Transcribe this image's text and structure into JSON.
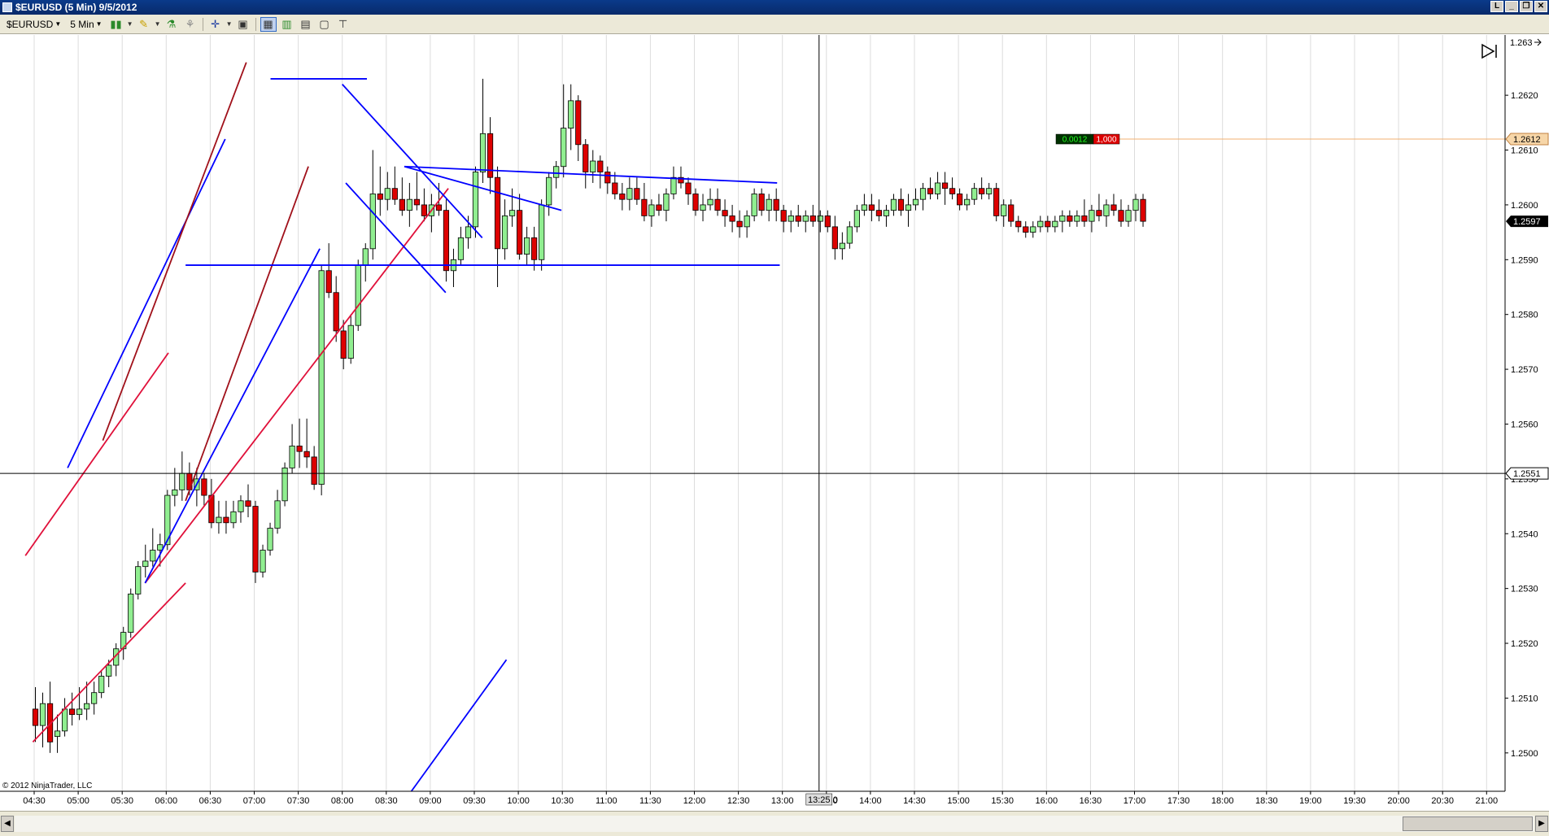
{
  "window": {
    "title": "$EURUSD (5 Min)  9/5/2012"
  },
  "toolbar": {
    "instrument": "$EURUSD",
    "interval": "5 Min"
  },
  "chart_data": {
    "type": "candlestick",
    "instrument": "$EURUSD",
    "interval": "5 Min",
    "date": "9/5/2012",
    "copyright": "© 2012 NinjaTrader, LLC",
    "ylim": [
      1.2493,
      1.2631
    ],
    "y_ticks": [
      "1.2500",
      "1.2510",
      "1.2520",
      "1.2530",
      "1.2540",
      "1.2550",
      "1.2560",
      "1.2570",
      "1.2580",
      "1.2590",
      "1.2600",
      "1.2610",
      "1.2620"
    ],
    "x_ticks": [
      "04:30",
      "05:00",
      "05:30",
      "06:00",
      "06:30",
      "07:00",
      "07:30",
      "08:00",
      "08:30",
      "09:00",
      "09:30",
      "10:00",
      "10:30",
      "11:00",
      "11:30",
      "12:00",
      "12:30",
      "13:00",
      "13:30",
      "14:00",
      "14:30",
      "15:00",
      "15:30",
      "16:00",
      "16:30",
      "17:00",
      "17:30",
      "18:00",
      "18:30",
      "19:00",
      "19:30",
      "20:00",
      "20:30",
      "21:00"
    ],
    "price_labels": {
      "top": "1.263",
      "order": "1.2612",
      "last": "1.2597",
      "crosshair": "1.2551"
    },
    "crosshair": {
      "time": "13:25",
      "price": 1.2551,
      "time_label": "13:25",
      "time_label_suffix": "0"
    },
    "order_line": {
      "price": 1.2612,
      "pnl": "0.0012",
      "qty": "1,000"
    },
    "candles": [
      [
        1.2508,
        1.2512,
        1.2502,
        1.2505
      ],
      [
        1.2505,
        1.2511,
        1.2501,
        1.2509
      ],
      [
        1.2509,
        1.2513,
        1.25,
        1.2502
      ],
      [
        1.2503,
        1.2507,
        1.25,
        1.2504
      ],
      [
        1.2504,
        1.251,
        1.2503,
        1.2508
      ],
      [
        1.2508,
        1.2511,
        1.2505,
        1.2507
      ],
      [
        1.2507,
        1.2512,
        1.2506,
        1.2508
      ],
      [
        1.2508,
        1.2513,
        1.2506,
        1.2509
      ],
      [
        1.2509,
        1.2513,
        1.2507,
        1.2511
      ],
      [
        1.2511,
        1.2515,
        1.251,
        1.2514
      ],
      [
        1.2514,
        1.2517,
        1.2512,
        1.2516
      ],
      [
        1.2516,
        1.252,
        1.2514,
        1.2519
      ],
      [
        1.2519,
        1.2523,
        1.2517,
        1.2522
      ],
      [
        1.2522,
        1.253,
        1.2521,
        1.2529
      ],
      [
        1.2529,
        1.2535,
        1.2528,
        1.2534
      ],
      [
        1.2534,
        1.2538,
        1.2532,
        1.2535
      ],
      [
        1.2535,
        1.2541,
        1.2534,
        1.2537
      ],
      [
        1.2537,
        1.254,
        1.2534,
        1.2538
      ],
      [
        1.2538,
        1.2548,
        1.2537,
        1.2547
      ],
      [
        1.2547,
        1.2552,
        1.2545,
        1.2548
      ],
      [
        1.2548,
        1.2555,
        1.2546,
        1.2551
      ],
      [
        1.2551,
        1.2553,
        1.2547,
        1.2548
      ],
      [
        1.2548,
        1.2552,
        1.2545,
        1.255
      ],
      [
        1.255,
        1.2551,
        1.2545,
        1.2547
      ],
      [
        1.2547,
        1.255,
        1.2541,
        1.2542
      ],
      [
        1.2542,
        1.2546,
        1.254,
        1.2543
      ],
      [
        1.2543,
        1.2546,
        1.254,
        1.2542
      ],
      [
        1.2542,
        1.2546,
        1.2541,
        1.2544
      ],
      [
        1.2544,
        1.2547,
        1.2542,
        1.2546
      ],
      [
        1.2546,
        1.2549,
        1.2543,
        1.2545
      ],
      [
        1.2545,
        1.2546,
        1.2531,
        1.2533
      ],
      [
        1.2533,
        1.2538,
        1.2532,
        1.2537
      ],
      [
        1.2537,
        1.2542,
        1.2536,
        1.2541
      ],
      [
        1.2541,
        1.2548,
        1.254,
        1.2546
      ],
      [
        1.2546,
        1.2553,
        1.2545,
        1.2552
      ],
      [
        1.2552,
        1.256,
        1.2551,
        1.2556
      ],
      [
        1.2556,
        1.2561,
        1.2552,
        1.2555
      ],
      [
        1.2555,
        1.2561,
        1.2552,
        1.2554
      ],
      [
        1.2554,
        1.2556,
        1.2548,
        1.2549
      ],
      [
        1.2549,
        1.2589,
        1.2547,
        1.2588
      ],
      [
        1.2588,
        1.2593,
        1.2583,
        1.2584
      ],
      [
        1.2584,
        1.2587,
        1.2575,
        1.2577
      ],
      [
        1.2577,
        1.2579,
        1.257,
        1.2572
      ],
      [
        1.2572,
        1.258,
        1.2571,
        1.2578
      ],
      [
        1.2578,
        1.259,
        1.2577,
        1.2589
      ],
      [
        1.2589,
        1.2593,
        1.2586,
        1.2592
      ],
      [
        1.2592,
        1.261,
        1.259,
        1.2602
      ],
      [
        1.2602,
        1.2607,
        1.2598,
        1.2601
      ],
      [
        1.2601,
        1.2606,
        1.2599,
        1.2603
      ],
      [
        1.2603,
        1.2607,
        1.26,
        1.2601
      ],
      [
        1.2601,
        1.2605,
        1.2598,
        1.2599
      ],
      [
        1.2599,
        1.2604,
        1.2596,
        1.2601
      ],
      [
        1.2601,
        1.2606,
        1.2599,
        1.26
      ],
      [
        1.26,
        1.2603,
        1.2597,
        1.2598
      ],
      [
        1.2598,
        1.2602,
        1.2595,
        1.26
      ],
      [
        1.26,
        1.2604,
        1.2598,
        1.2599
      ],
      [
        1.2599,
        1.2601,
        1.2586,
        1.2588
      ],
      [
        1.2588,
        1.2592,
        1.2585,
        1.259
      ],
      [
        1.259,
        1.2596,
        1.2589,
        1.2594
      ],
      [
        1.2594,
        1.2598,
        1.2592,
        1.2596
      ],
      [
        1.2596,
        1.2607,
        1.2594,
        1.2606
      ],
      [
        1.2606,
        1.2623,
        1.2604,
        1.2613
      ],
      [
        1.2613,
        1.2616,
        1.2602,
        1.2605
      ],
      [
        1.2605,
        1.2607,
        1.2585,
        1.2592
      ],
      [
        1.2592,
        1.2601,
        1.259,
        1.2598
      ],
      [
        1.2598,
        1.2603,
        1.2596,
        1.2599
      ],
      [
        1.2599,
        1.2602,
        1.259,
        1.2591
      ],
      [
        1.2591,
        1.2596,
        1.2589,
        1.2594
      ],
      [
        1.2594,
        1.2596,
        1.2588,
        1.259
      ],
      [
        1.259,
        1.2601,
        1.2588,
        1.26
      ],
      [
        1.26,
        1.2606,
        1.2598,
        1.2605
      ],
      [
        1.2605,
        1.2608,
        1.2603,
        1.2607
      ],
      [
        1.2607,
        1.2622,
        1.2605,
        1.2614
      ],
      [
        1.2614,
        1.2622,
        1.261,
        1.2619
      ],
      [
        1.2619,
        1.262,
        1.2608,
        1.2611
      ],
      [
        1.2611,
        1.2612,
        1.2603,
        1.2606
      ],
      [
        1.2606,
        1.261,
        1.2604,
        1.2608
      ],
      [
        1.2608,
        1.2609,
        1.2603,
        1.2606
      ],
      [
        1.2606,
        1.2607,
        1.2602,
        1.2604
      ],
      [
        1.2604,
        1.2606,
        1.2601,
        1.2602
      ],
      [
        1.2602,
        1.2604,
        1.2599,
        1.2601
      ],
      [
        1.2601,
        1.2605,
        1.2599,
        1.2603
      ],
      [
        1.2603,
        1.2605,
        1.26,
        1.2601
      ],
      [
        1.2601,
        1.2604,
        1.2597,
        1.2598
      ],
      [
        1.2598,
        1.2601,
        1.2596,
        1.26
      ],
      [
        1.26,
        1.2602,
        1.2598,
        1.2599
      ],
      [
        1.2599,
        1.2603,
        1.2597,
        1.2602
      ],
      [
        1.2602,
        1.2607,
        1.2601,
        1.2605
      ],
      [
        1.2605,
        1.2607,
        1.2603,
        1.2604
      ],
      [
        1.2604,
        1.2605,
        1.26,
        1.2602
      ],
      [
        1.2602,
        1.2603,
        1.2598,
        1.2599
      ],
      [
        1.2599,
        1.2602,
        1.2597,
        1.26
      ],
      [
        1.26,
        1.2603,
        1.2599,
        1.2601
      ],
      [
        1.2601,
        1.2603,
        1.2598,
        1.2599
      ],
      [
        1.2599,
        1.2601,
        1.2596,
        1.2598
      ],
      [
        1.2598,
        1.26,
        1.2595,
        1.2597
      ],
      [
        1.2597,
        1.2599,
        1.2594,
        1.2596
      ],
      [
        1.2596,
        1.2599,
        1.2594,
        1.2598
      ],
      [
        1.2598,
        1.2603,
        1.2597,
        1.2602
      ],
      [
        1.2602,
        1.2603,
        1.2598,
        1.2599
      ],
      [
        1.2599,
        1.2602,
        1.2597,
        1.2601
      ],
      [
        1.2601,
        1.2603,
        1.2597,
        1.2599
      ],
      [
        1.2599,
        1.26,
        1.2595,
        1.2597
      ],
      [
        1.2597,
        1.2599,
        1.2595,
        1.2598
      ],
      [
        1.2598,
        1.26,
        1.2596,
        1.2597
      ],
      [
        1.2597,
        1.2599,
        1.2595,
        1.2598
      ],
      [
        1.2598,
        1.26,
        1.2596,
        1.2597
      ],
      [
        1.2597,
        1.2599,
        1.2595,
        1.2598
      ],
      [
        1.2598,
        1.2599,
        1.2595,
        1.2596
      ],
      [
        1.2596,
        1.2598,
        1.259,
        1.2592
      ],
      [
        1.2592,
        1.2595,
        1.259,
        1.2593
      ],
      [
        1.2593,
        1.2597,
        1.2592,
        1.2596
      ],
      [
        1.2596,
        1.26,
        1.2595,
        1.2599
      ],
      [
        1.2599,
        1.2602,
        1.2598,
        1.26
      ],
      [
        1.26,
        1.2602,
        1.2597,
        1.2599
      ],
      [
        1.2599,
        1.2601,
        1.2597,
        1.2598
      ],
      [
        1.2598,
        1.26,
        1.2596,
        1.2599
      ],
      [
        1.2599,
        1.2602,
        1.2598,
        1.2601
      ],
      [
        1.2601,
        1.2603,
        1.2598,
        1.2599
      ],
      [
        1.2599,
        1.2602,
        1.2596,
        1.26
      ],
      [
        1.26,
        1.2603,
        1.2599,
        1.2601
      ],
      [
        1.2601,
        1.2604,
        1.2599,
        1.2603
      ],
      [
        1.2603,
        1.2605,
        1.2601,
        1.2602
      ],
      [
        1.2602,
        1.2606,
        1.2601,
        1.2604
      ],
      [
        1.2604,
        1.2606,
        1.26,
        1.2603
      ],
      [
        1.2603,
        1.2605,
        1.2601,
        1.2602
      ],
      [
        1.2602,
        1.2603,
        1.2599,
        1.26
      ],
      [
        1.26,
        1.2602,
        1.2599,
        1.2601
      ],
      [
        1.2601,
        1.2604,
        1.26,
        1.2603
      ],
      [
        1.2603,
        1.2605,
        1.2601,
        1.2602
      ],
      [
        1.2602,
        1.2604,
        1.2601,
        1.2603
      ],
      [
        1.2603,
        1.2604,
        1.2597,
        1.2598
      ],
      [
        1.2598,
        1.2601,
        1.2596,
        1.26
      ],
      [
        1.26,
        1.2601,
        1.2596,
        1.2597
      ],
      [
        1.2597,
        1.2598,
        1.2595,
        1.2596
      ],
      [
        1.2596,
        1.2597,
        1.2594,
        1.2595
      ],
      [
        1.2595,
        1.2597,
        1.2594,
        1.2596
      ],
      [
        1.2596,
        1.2598,
        1.2595,
        1.2597
      ],
      [
        1.2597,
        1.2598,
        1.2595,
        1.2596
      ],
      [
        1.2596,
        1.2598,
        1.2595,
        1.2597
      ],
      [
        1.2597,
        1.2599,
        1.2595,
        1.2598
      ],
      [
        1.2598,
        1.2599,
        1.2596,
        1.2597
      ],
      [
        1.2597,
        1.2599,
        1.2596,
        1.2598
      ],
      [
        1.2598,
        1.2601,
        1.2596,
        1.2597
      ],
      [
        1.2597,
        1.26,
        1.2595,
        1.2599
      ],
      [
        1.2599,
        1.2602,
        1.2597,
        1.2598
      ],
      [
        1.2598,
        1.2601,
        1.2596,
        1.26
      ],
      [
        1.26,
        1.2602,
        1.2598,
        1.2599
      ],
      [
        1.2599,
        1.2601,
        1.2596,
        1.2597
      ],
      [
        1.2597,
        1.26,
        1.2596,
        1.2599
      ],
      [
        1.2599,
        1.2602,
        1.2597,
        1.2601
      ],
      [
        1.2601,
        1.2602,
        1.2596,
        1.2597
      ]
    ],
    "drawings": [
      {
        "kind": "line",
        "color": "#0000ff",
        "t1": 0.76,
        "p1": 1.2552,
        "t2": 4.34,
        "p2": 1.2612
      },
      {
        "kind": "line",
        "color": "#a0101a",
        "t1": 1.56,
        "p1": 1.2557,
        "t2": 4.82,
        "p2": 1.2626
      },
      {
        "kind": "line",
        "color": "#e0103a",
        "t1": -0.2,
        "p1": 1.2536,
        "t2": 3.05,
        "p2": 1.2573
      },
      {
        "kind": "line",
        "color": "#e0103a",
        "t1": -0.03,
        "p1": 1.2502,
        "t2": 3.44,
        "p2": 1.2531
      },
      {
        "kind": "line",
        "color": "#e0103a",
        "t1": 2.52,
        "p1": 1.2531,
        "t2": 9.41,
        "p2": 1.2603
      },
      {
        "kind": "line",
        "color": "#0000ff",
        "t1": 2.52,
        "p1": 1.2531,
        "t2": 6.49,
        "p2": 1.2592
      },
      {
        "kind": "line",
        "color": "#a0101a",
        "t1": 3.44,
        "p1": 1.2546,
        "t2": 6.23,
        "p2": 1.2607
      },
      {
        "kind": "line",
        "color": "#0000ff",
        "t1": 3.44,
        "p1": 1.2589,
        "t2": 16.94,
        "p2": 1.2589
      },
      {
        "kind": "line",
        "color": "#0000ff",
        "t1": 5.37,
        "p1": 1.2623,
        "t2": 7.56,
        "p2": 1.2623
      },
      {
        "kind": "line",
        "color": "#0000ff",
        "t1": 7.0,
        "p1": 1.2622,
        "t2": 10.18,
        "p2": 1.2594
      },
      {
        "kind": "line",
        "color": "#0000ff",
        "t1": 7.08,
        "p1": 1.2604,
        "t2": 9.35,
        "p2": 1.2584
      },
      {
        "kind": "line",
        "color": "#0000ff",
        "t1": 8.41,
        "p1": 1.2607,
        "t2": 11.98,
        "p2": 1.2599
      },
      {
        "kind": "line",
        "color": "#0000ff",
        "t1": 8.41,
        "p1": 1.2607,
        "t2": 16.88,
        "p2": 1.2604
      },
      {
        "kind": "line",
        "color": "#0000ff",
        "t1": 8.57,
        "p1": 1.2493,
        "t2": 10.73,
        "p2": 1.2517
      }
    ]
  }
}
